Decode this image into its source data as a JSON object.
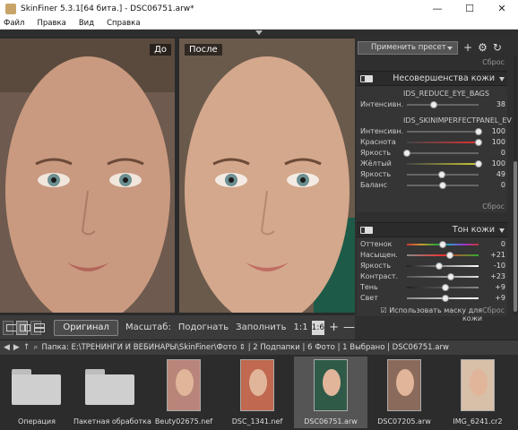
{
  "window": {
    "title": "SkinFiner 5.3.1[64 бита.] - DSC06751.arw*",
    "minimize": "—",
    "maximize": "☐",
    "close": "✕"
  },
  "menu": [
    "Файл",
    "Правка",
    "Вид",
    "Справка"
  ],
  "viewer": {
    "before_label": "До",
    "after_label": "После"
  },
  "viewbar": {
    "original_label": "Оригинал",
    "scale_label": "Масштаб:",
    "fit_label": "Подогнать",
    "fill_label": "Заполнить",
    "ratio_label": "1:1",
    "zoom_value": "1:6",
    "plus": "+",
    "minus": "—"
  },
  "panel": {
    "preset_label": "Применить пресет",
    "reset_top": "Сброс",
    "imperfections": {
      "title": "Несовершенства кожи",
      "sub1": "IDS_REDUCE_EYE_BAGS",
      "sub2": "IDS_SKINIMPERFECTPANEL_EV",
      "reset": "Сброс",
      "group1": [
        {
          "label": "Интенсивн.",
          "value": "38",
          "level": 0.38
        }
      ],
      "group2": [
        {
          "label": "Интенсивн.",
          "value": "100",
          "level": 1.0
        },
        {
          "label": "Краснота",
          "value": "100",
          "level": 1.0
        },
        {
          "label": "Яркость",
          "value": "0",
          "level": 0.0
        },
        {
          "label": "Жёлтый",
          "value": "100",
          "level": 1.0
        },
        {
          "label": "Яркость",
          "value": "49",
          "level": 0.49
        },
        {
          "label": "Баланс",
          "value": "0",
          "level": 0.5
        }
      ]
    },
    "tone": {
      "title": "Тон кожи",
      "mask_label": "Использовать маску для кожи",
      "reset": "Сброс",
      "sliders": [
        {
          "label": "Оттенок",
          "value": "0",
          "level": 0.5
        },
        {
          "label": "Насыщен.",
          "value": "+21",
          "level": 0.6
        },
        {
          "label": "Яркость",
          "value": "-10",
          "level": 0.45
        },
        {
          "label": "Контраст.",
          "value": "+23",
          "level": 0.61
        },
        {
          "label": "Тень",
          "value": "+9",
          "level": 0.54
        },
        {
          "label": "Свет",
          "value": "+9",
          "level": 0.54
        }
      ]
    }
  },
  "pathbar": {
    "text": "Папка:  E:\\ТРЕНИНГИ И ВЕБИНАРЫ\\SkinFiner\\Фото ⇕ | 2 Подпапки | 6 Фото | 1 Выбрано | DSC06751.arw"
  },
  "filmstrip": [
    {
      "name": "Операция",
      "kind": "folder"
    },
    {
      "name": "Пакетная обработка",
      "kind": "folder"
    },
    {
      "name": "Beuty02675.nef",
      "kind": "photo",
      "tone": "#b9857a"
    },
    {
      "name": "DSC_1341.nef",
      "kind": "photo",
      "tone": "#c06850"
    },
    {
      "name": "DSC06751.arw",
      "kind": "photo",
      "tone": "#2f5a48",
      "selected": true
    },
    {
      "name": "DSC07205.arw",
      "kind": "photo",
      "tone": "#8a6a5a"
    },
    {
      "name": "IMG_6241.cr2",
      "kind": "photo",
      "tone": "#d8c0a8"
    }
  ],
  "colors": {
    "accent": "#e07a3a",
    "panel_bg": "#2f2f2f",
    "viewer_bg": "#2a2a2a"
  }
}
